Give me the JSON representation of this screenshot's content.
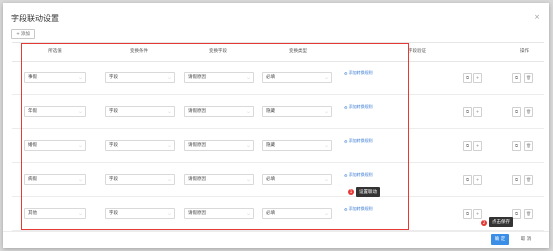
{
  "dialog": {
    "title": "字段联动设置",
    "close_symbol": "×"
  },
  "toolbar": {
    "add_label": "添加",
    "add_symbol": "+"
  },
  "table": {
    "headers": [
      "所选值",
      "变换条件",
      "变换字段",
      "变换类型",
      "字段验证",
      "操作"
    ]
  },
  "rows": [
    {
      "value": "事假",
      "condition": "字段",
      "field": "请假原因",
      "type": "必填",
      "link": "添加转换规则"
    },
    {
      "value": "年假",
      "condition": "字段",
      "field": "请假原因",
      "type": "隐藏",
      "link": "添加转换规则"
    },
    {
      "value": "婚假",
      "condition": "字段",
      "field": "请假原因",
      "type": "隐藏",
      "link": "添加转换规则"
    },
    {
      "value": "病假",
      "condition": "字段",
      "field": "请假原因",
      "type": "必填",
      "link": "添加转换规则"
    },
    {
      "value": "其他",
      "condition": "字段",
      "field": "请假原因",
      "type": "必填",
      "link": "添加转换规则"
    }
  ],
  "annotations": {
    "tip1": {
      "badge": "1",
      "text": "设置联动"
    },
    "tip2": {
      "badge": "2",
      "text": "点击保存"
    }
  },
  "footer": {
    "ok_label": "确 定",
    "cancel_label": "取 消"
  },
  "colors": {
    "accent": "#3a8ee6",
    "highlight": "#e53935"
  }
}
